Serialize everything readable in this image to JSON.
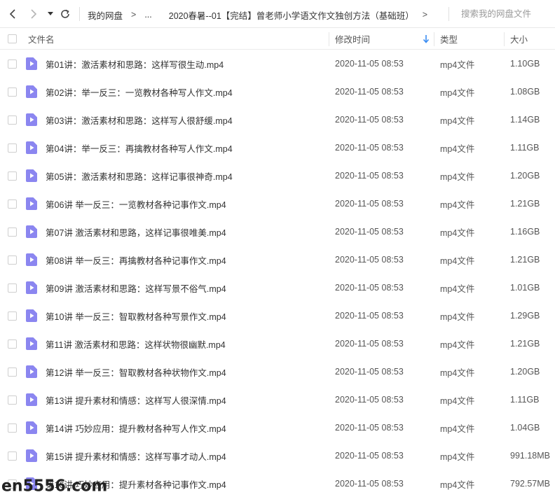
{
  "toolbar": {
    "breadcrumb_root": "我的网盘",
    "breadcrumb_sep": ">",
    "breadcrumb_ellipsis": "...",
    "breadcrumb_current": "2020春暑--01【完结】曾老师小学语文作文独创方法（基础班）",
    "breadcrumb_tail_sep": ">",
    "search_placeholder": "搜索我的网盘文件",
    "icons": [
      "back-icon",
      "forward-icon",
      "history-dropdown-icon",
      "refresh-icon"
    ]
  },
  "header": {
    "name": "文件名",
    "modified": "修改时间",
    "type": "类型",
    "size": "大小",
    "sort_icon": "sort-descending-arrow-icon"
  },
  "colors": {
    "file_icon": "#8b86f0",
    "sort_arrow": "#3b8df2"
  },
  "files": [
    {
      "name": "第01讲：激活素材和思路：这样写很生动.mp4",
      "modified": "2020-11-05 08:53",
      "type": "mp4文件",
      "size": "1.10GB"
    },
    {
      "name": "第02讲：举一反三：一览教材各种写人作文.mp4",
      "modified": "2020-11-05 08:53",
      "type": "mp4文件",
      "size": "1.08GB"
    },
    {
      "name": "第03讲：激活素材和思路：这样写人很舒缓.mp4",
      "modified": "2020-11-05 08:53",
      "type": "mp4文件",
      "size": "1.14GB"
    },
    {
      "name": "第04讲：举一反三：再擒教材各种写人作文.mp4",
      "modified": "2020-11-05 08:53",
      "type": "mp4文件",
      "size": "1.11GB"
    },
    {
      "name": "第05讲：激活素材和思路：这样记事很神奇.mp4",
      "modified": "2020-11-05 08:53",
      "type": "mp4文件",
      "size": "1.20GB"
    },
    {
      "name": "第06讲 举一反三：一览教材各种记事作文.mp4",
      "modified": "2020-11-05 08:53",
      "type": "mp4文件",
      "size": "1.21GB"
    },
    {
      "name": "第07讲 激活素材和思路，这样记事很唯美.mp4",
      "modified": "2020-11-05 08:53",
      "type": "mp4文件",
      "size": "1.16GB"
    },
    {
      "name": "第08讲 举一反三：再擒教材各种记事作文.mp4",
      "modified": "2020-11-05 08:53",
      "type": "mp4文件",
      "size": "1.21GB"
    },
    {
      "name": "第09讲 激活素材和思路：这样写景不俗气.mp4",
      "modified": "2020-11-05 08:53",
      "type": "mp4文件",
      "size": "1.01GB"
    },
    {
      "name": "第10讲 举一反三：智取教材各种写景作文.mp4",
      "modified": "2020-11-05 08:53",
      "type": "mp4文件",
      "size": "1.29GB"
    },
    {
      "name": "第11讲 激活素材和思路：这样状物很幽默.mp4",
      "modified": "2020-11-05 08:53",
      "type": "mp4文件",
      "size": "1.21GB"
    },
    {
      "name": "第12讲 举一反三：智取教材各种状物作文.mp4",
      "modified": "2020-11-05 08:53",
      "type": "mp4文件",
      "size": "1.20GB"
    },
    {
      "name": "第13讲 提升素材和情感：这样写人很深情.mp4",
      "modified": "2020-11-05 08:53",
      "type": "mp4文件",
      "size": "1.11GB"
    },
    {
      "name": "第14讲 巧妙应用：提升教材各种写人作文.mp4",
      "modified": "2020-11-05 08:53",
      "type": "mp4文件",
      "size": "1.04GB"
    },
    {
      "name": "第15讲 提升素材和情感：这样写事才动人.mp4",
      "modified": "2020-11-05 08:53",
      "type": "mp4文件",
      "size": "991.18MB"
    },
    {
      "name": "第16讲 巧妙应用：提升素材各种记事作文.mp4",
      "modified": "2020-11-05 08:53",
      "type": "mp4文件",
      "size": "792.57MB"
    }
  ],
  "watermark": "en5556.com"
}
